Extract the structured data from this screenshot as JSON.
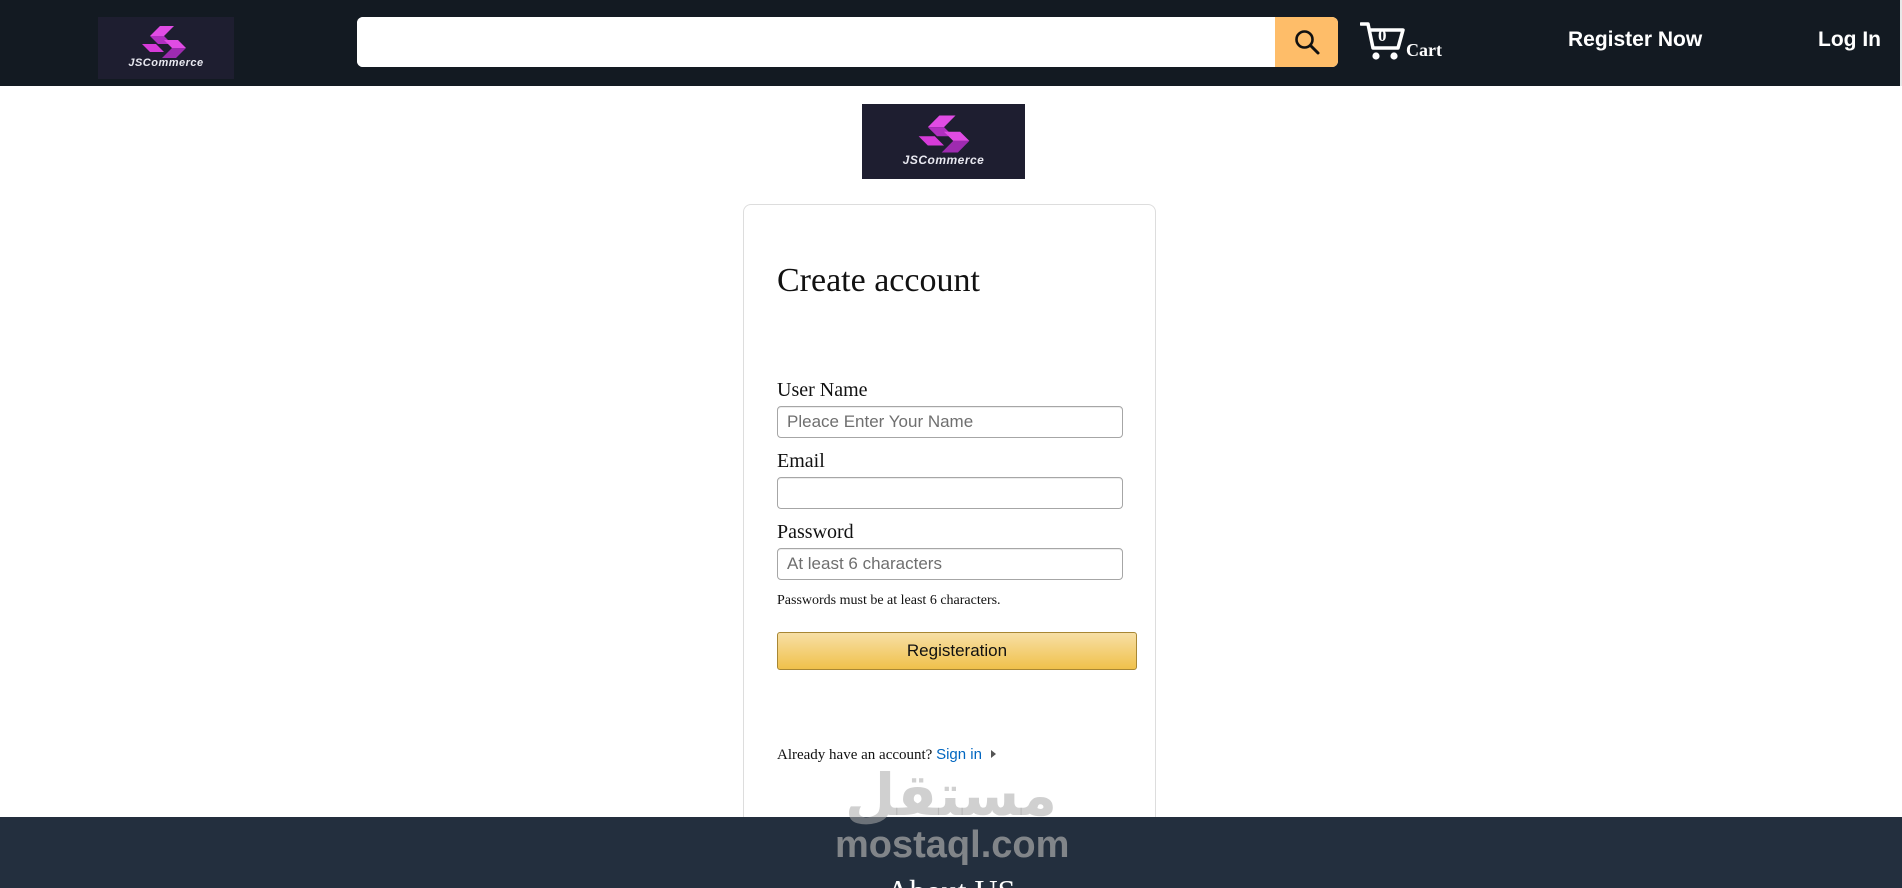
{
  "header": {
    "logo_text": "JSCommerce",
    "search": {
      "value": "",
      "placeholder": ""
    },
    "cart": {
      "count": "0",
      "label": "Cart"
    },
    "nav": {
      "register": "Register Now",
      "login": "Log In"
    }
  },
  "center_logo": {
    "text": "JSCommerce"
  },
  "form": {
    "title": "Create account",
    "username": {
      "label": "User Name",
      "placeholder": "Pleace Enter Your Name",
      "value": ""
    },
    "email": {
      "label": "Email",
      "placeholder": "",
      "value": ""
    },
    "password": {
      "label": "Password",
      "placeholder": "At least 6 characters",
      "value": ""
    },
    "hint": "Passwords must be at least 6 characters.",
    "submit_label": "Registeration",
    "signin_prompt": "Already have an account?",
    "signin_link": "Sign in"
  },
  "footer": {
    "title": "About US"
  },
  "watermark": {
    "arabic": "مستقل",
    "latin": "mostaql.com"
  },
  "icons": {
    "logo": "jscommerce-logo-icon",
    "search": "search-icon",
    "cart": "cart-icon",
    "signin_caret": "caret-right-icon"
  },
  "colors": {
    "header_bg": "#131a22",
    "search_button": "#febd69",
    "button_top": "#f7dfa5",
    "button_bottom": "#f0c14b",
    "link": "#0066c0",
    "footer_bg": "#232f3e",
    "logo_accent": "#d63bd9"
  }
}
